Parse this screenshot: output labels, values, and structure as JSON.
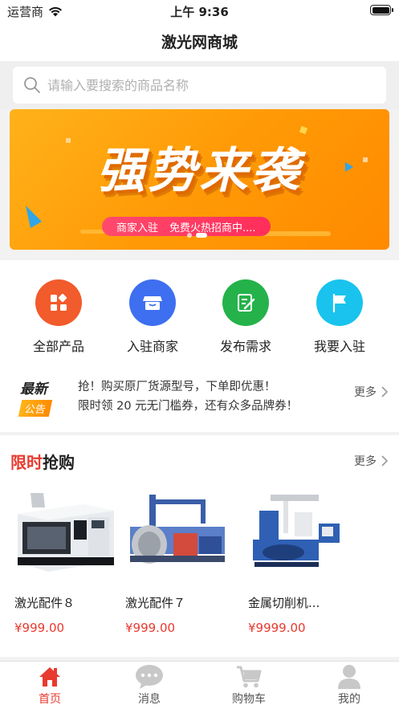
{
  "status_bar": {
    "carrier": "运营商",
    "time": "上午 9:36"
  },
  "nav": {
    "title": "激光网商城"
  },
  "search": {
    "placeholder": "请输入要搜索的商品名称"
  },
  "banner": {
    "title": "强势来袭",
    "pill_left": "商家入驻",
    "pill_right": "免费火热招商中....",
    "colors": {
      "bg": "#ff9a06",
      "pill": "#ff2e5a"
    }
  },
  "categories": [
    {
      "label": "全部产品",
      "icon": "grid-icon",
      "color": "#f25b2b"
    },
    {
      "label": "入驻商家",
      "icon": "store-icon",
      "color": "#3d6ff0"
    },
    {
      "label": "发布需求",
      "icon": "edit-icon",
      "color": "#25b24a"
    },
    {
      "label": "我要入驻",
      "icon": "flag-icon",
      "color": "#19c3ee"
    }
  ],
  "notice": {
    "badge_line1": "最新",
    "badge_line2": "公告",
    "lines": [
      "抢！购买原厂货源型号，下单即优惠！",
      "限时领 20 元无门槛券，还有众多品牌券！"
    ],
    "more": "更多"
  },
  "flash_sale": {
    "title_red": "限时",
    "title_black": "抢购",
    "more": "更多",
    "products": [
      {
        "name": "激光配件８",
        "price": "¥999.00"
      },
      {
        "name": "激光配件７",
        "price": "¥999.00"
      },
      {
        "name": "金属切削机...",
        "price": "¥9999.00"
      }
    ]
  },
  "tabbar": {
    "items": [
      {
        "label": "首页",
        "icon": "home-icon",
        "active": true
      },
      {
        "label": "消息",
        "icon": "message-icon",
        "active": false
      },
      {
        "label": "购物车",
        "icon": "cart-icon",
        "active": false
      },
      {
        "label": "我的",
        "icon": "user-icon",
        "active": false
      }
    ],
    "colors": {
      "active": "#e83a2f",
      "inactive": "#c8c8c8"
    }
  }
}
